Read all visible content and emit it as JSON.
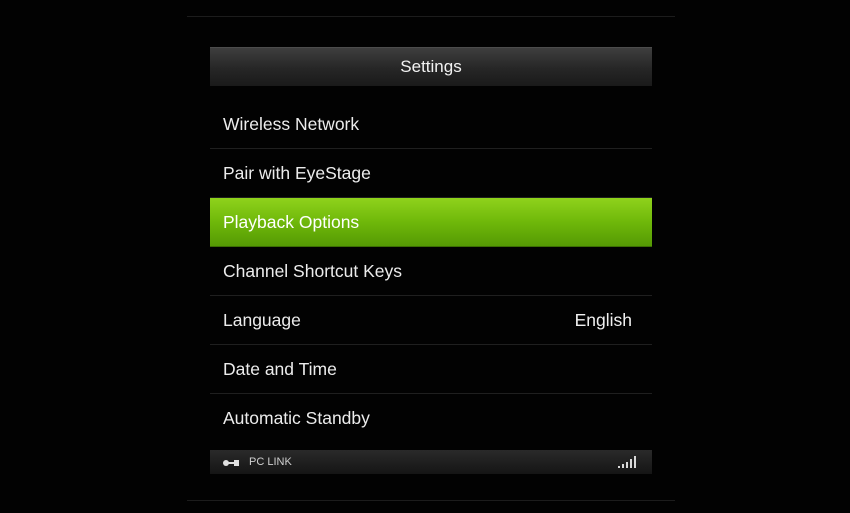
{
  "settings": {
    "title": "Settings"
  },
  "menu": {
    "items": [
      {
        "label": "Wireless Network",
        "value": ""
      },
      {
        "label": "Pair with EyeStage",
        "value": ""
      },
      {
        "label": "Playback Options",
        "value": "",
        "selected": true
      },
      {
        "label": "Channel Shortcut Keys",
        "value": ""
      },
      {
        "label": "Language",
        "value": "English"
      },
      {
        "label": "Date and Time",
        "value": ""
      },
      {
        "label": "Automatic Standby",
        "value": ""
      }
    ]
  },
  "status_bar": {
    "connection_label": "PC LINK",
    "connection_icon": "link-icon",
    "signal_icon": "signal-strength-icon",
    "signal_level": 1.0
  },
  "colors": {
    "selected_accent": "#6fb80a",
    "background": "#000000"
  }
}
